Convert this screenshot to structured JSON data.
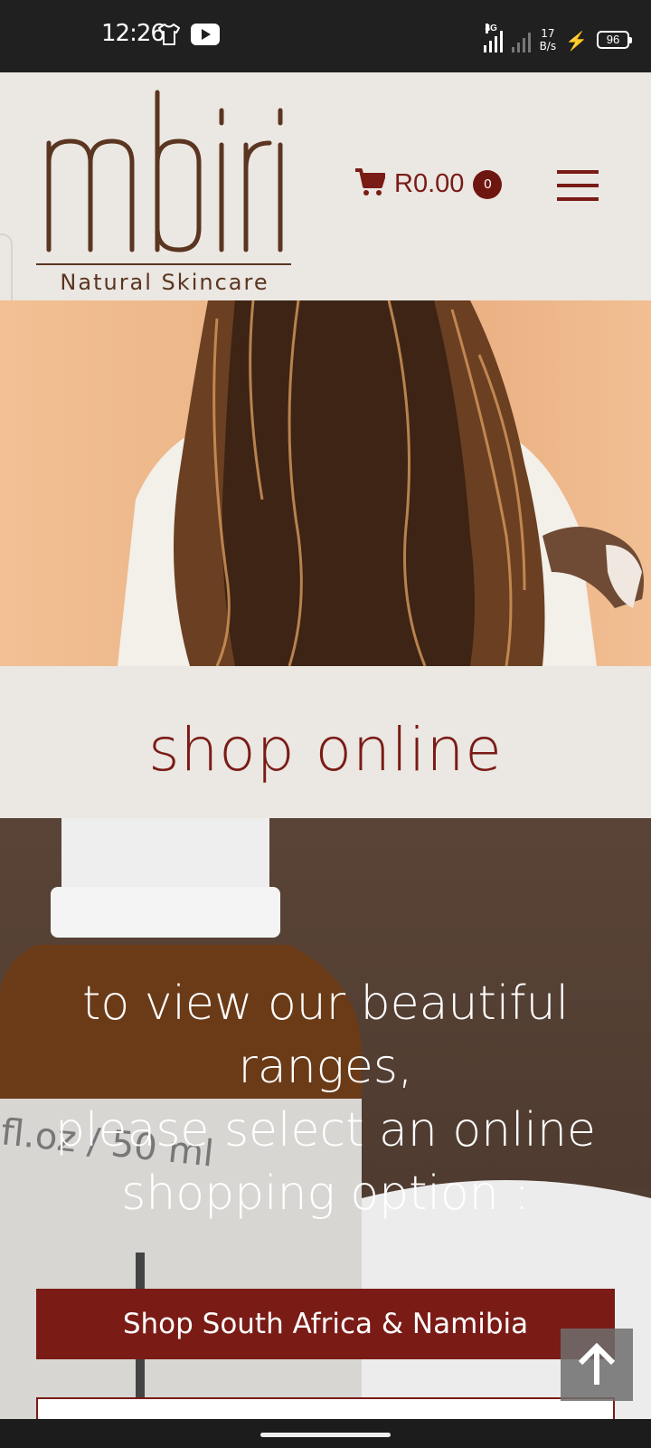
{
  "status_bar": {
    "time": "12:26",
    "network_label": "4G",
    "speed_value": "17",
    "speed_unit": "B/s",
    "battery": "96",
    "icons": [
      "tshirt-icon",
      "youtube-icon",
      "signal-icon",
      "charging-icon",
      "battery-icon"
    ]
  },
  "header": {
    "logo_name": "mbiri",
    "logo_tagline": "Natural Skincare",
    "cart_total": "R0.00",
    "cart_count": "0",
    "icons": [
      "cart-icon",
      "hamburger-menu-icon"
    ]
  },
  "shop": {
    "title": "shop online",
    "intro_lines": [
      "to view our beautiful",
      "ranges,",
      "please select an online",
      "shopping option :"
    ],
    "primary_button": "Shop South Africa & Namibia",
    "secondary_button": ""
  },
  "colors": {
    "brand": "#7a1b16",
    "header_bg": "#ebe7e2",
    "status_bg": "#202020"
  }
}
